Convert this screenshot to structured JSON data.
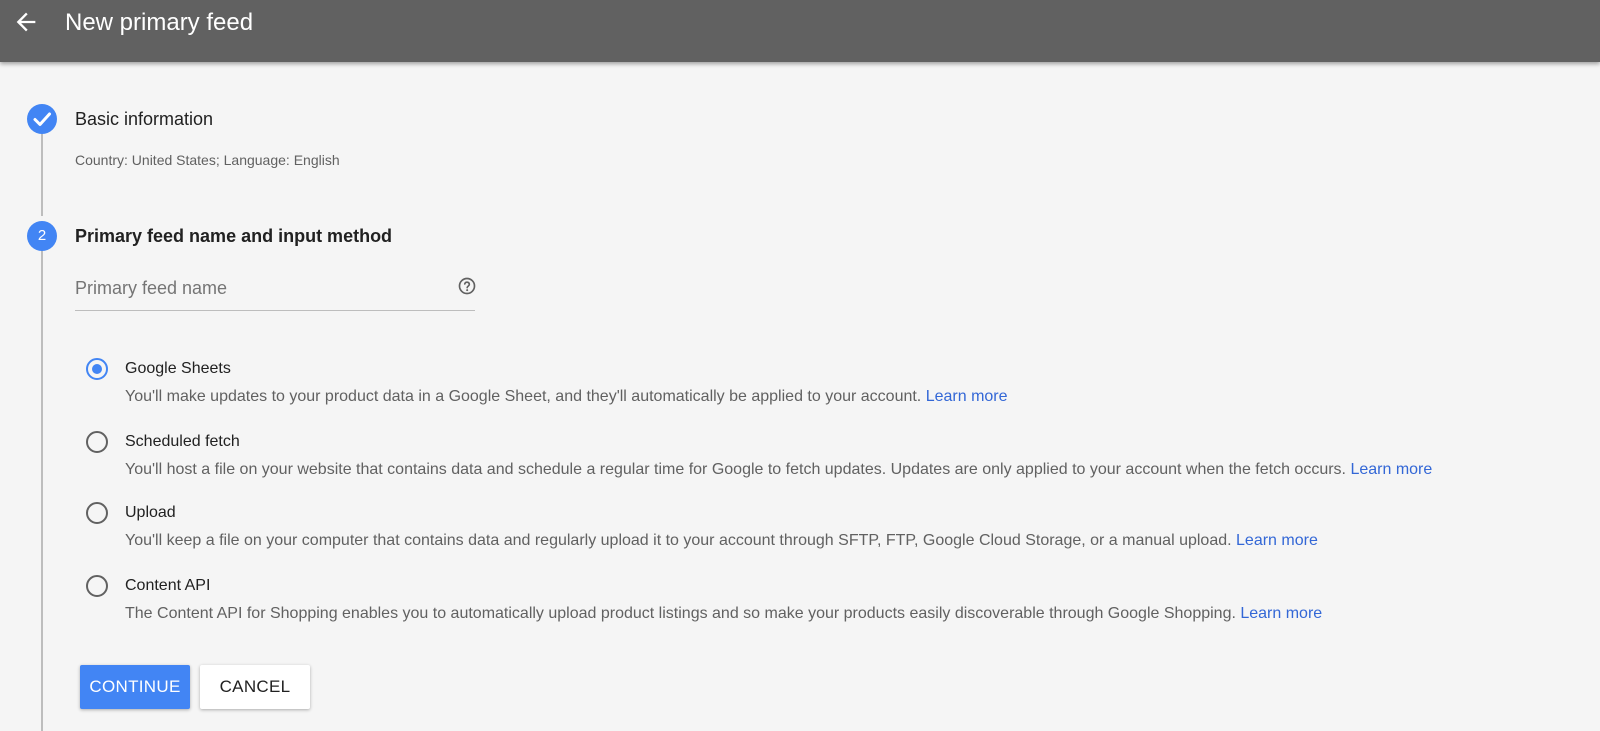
{
  "header": {
    "title": "New primary feed",
    "back_icon": "arrow-back-icon",
    "background": "#616161"
  },
  "steps": [
    {
      "indicator": "check-icon",
      "title": "Basic information",
      "summary": "Country: United States; Language: English"
    },
    {
      "indicator": "2",
      "title": "Primary feed name and input method"
    }
  ],
  "feed_name": {
    "value": "",
    "placeholder": "Primary feed name",
    "help_icon": "help-circle-icon"
  },
  "input_methods": {
    "selected": "Google Sheets",
    "options": [
      {
        "label": "Google Sheets",
        "description": "You'll make updates to your product data in a Google Sheet, and they'll automatically be applied to your account.",
        "link": "Learn more",
        "checked": true
      },
      {
        "label": "Scheduled fetch",
        "description": "You'll host a file on your website that contains data and schedule a regular time for Google to fetch updates. Updates are only applied to your account when the fetch occurs.",
        "link": "Learn more",
        "checked": false
      },
      {
        "label": "Upload",
        "description": "You'll keep a file on your computer that contains data and regularly upload it to your account through SFTP, FTP, Google Cloud Storage, or a manual upload.",
        "link": "Learn more",
        "checked": false
      },
      {
        "label": "Content API",
        "description": "The Content API for Shopping enables you to automatically upload product listings and so make your products easily discoverable through Google Shopping.",
        "link": "Learn more",
        "checked": false
      }
    ]
  },
  "actions": {
    "continue_label": "CONTINUE",
    "cancel_label": "CANCEL"
  },
  "colors": {
    "accent": "#4285f4",
    "link": "#3367d6",
    "background": "#f5f5f5"
  }
}
